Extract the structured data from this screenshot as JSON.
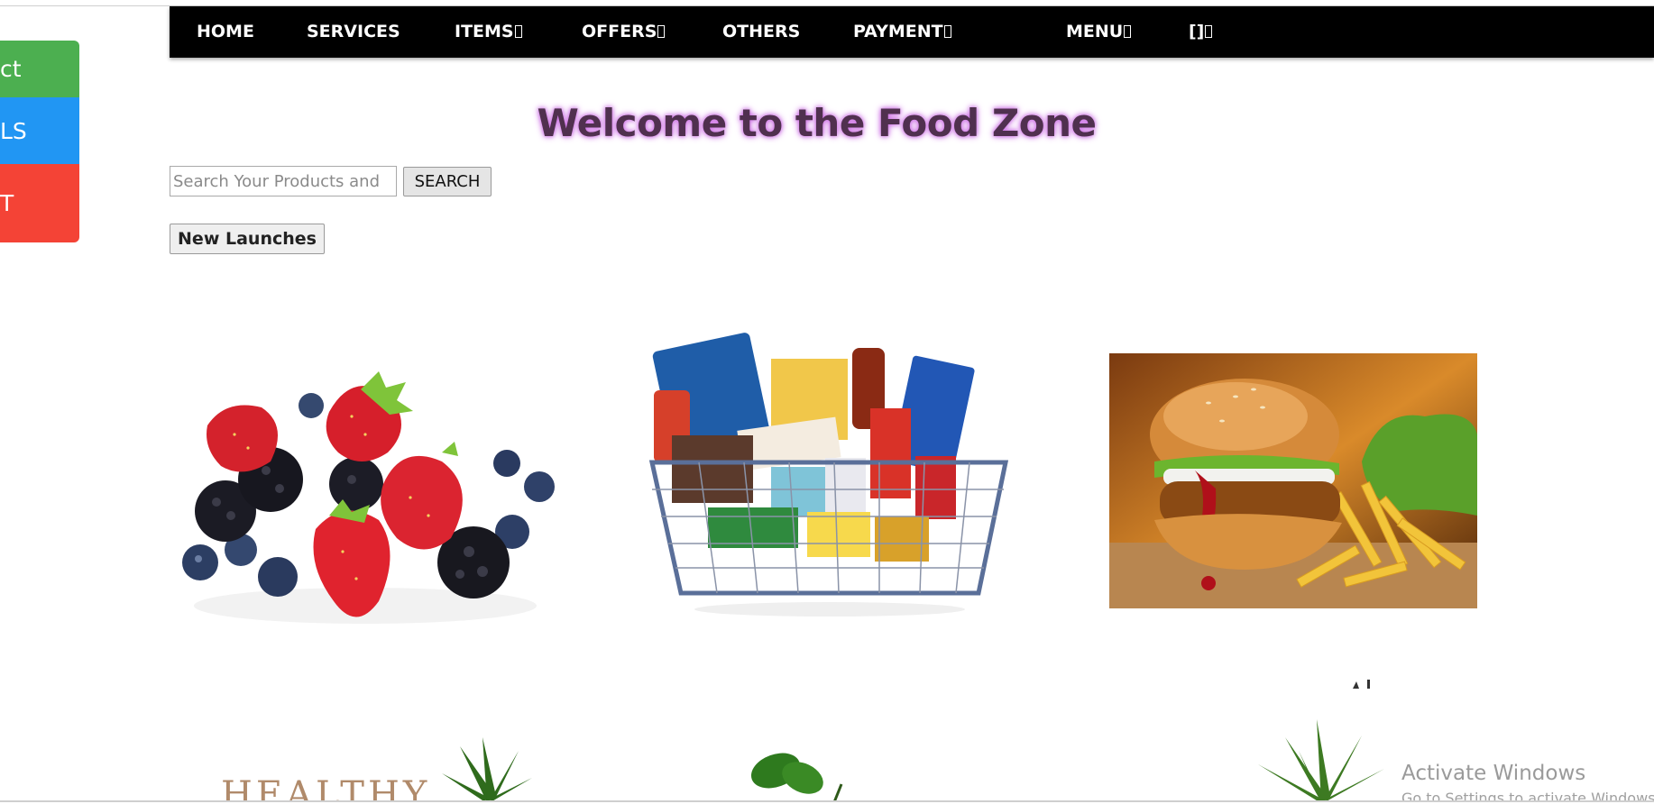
{
  "navbar": {
    "items": [
      {
        "label": "HOME",
        "has_glyph": false
      },
      {
        "label": "SERVICES",
        "has_glyph": false
      },
      {
        "label": "ITEMS",
        "has_glyph": true
      },
      {
        "label": "OFFERS",
        "has_glyph": true
      },
      {
        "label": "OTHERS",
        "has_glyph": false
      },
      {
        "label": "PAYMENT",
        "has_glyph": true
      },
      {
        "label": "MENU",
        "has_glyph": true
      },
      {
        "label": "[]",
        "has_glyph": true
      }
    ]
  },
  "side_buttons": [
    {
      "label": "ct",
      "color": "#4caf50"
    },
    {
      "label": "LS",
      "color": "#2196f3"
    },
    {
      "label": "T",
      "color": "#f44336"
    }
  ],
  "heading": "Welcome to the Food Zone",
  "search": {
    "placeholder": "Search Your Products and",
    "button_label": "SEARCH"
  },
  "new_launches_label": "New Launches",
  "products": [
    {
      "icon": "berries-image"
    },
    {
      "icon": "grocery-basket-image"
    },
    {
      "icon": "burger-fries-image"
    }
  ],
  "banner_text": "HEALTHY",
  "watermark": {
    "title": "Activate Windows",
    "subtitle": "Go to Settings to activate Windows."
  },
  "colors": {
    "navbar_bg": "#000000",
    "heading_text": "#50304f",
    "heading_glow": "#c860e0"
  }
}
